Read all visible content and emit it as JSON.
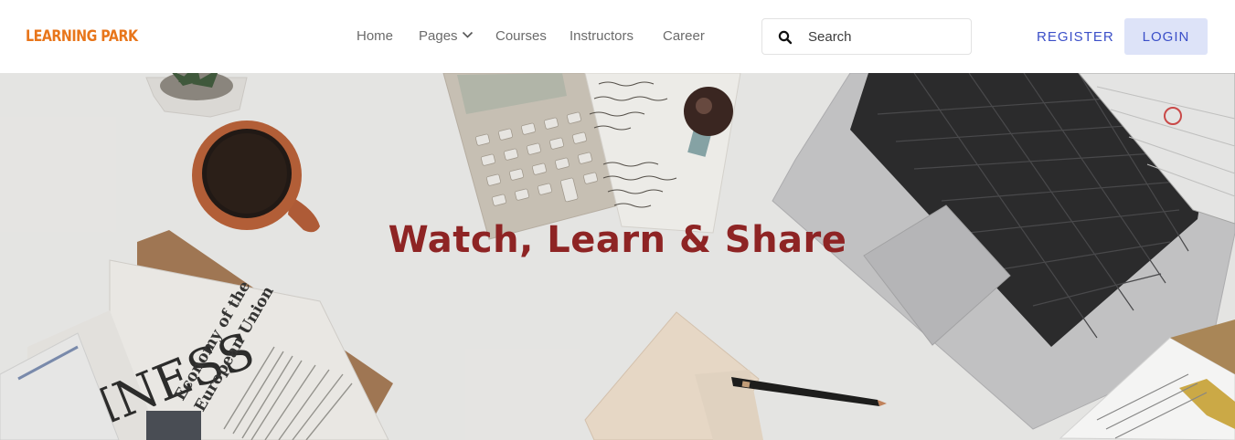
{
  "brand": {
    "logo_text": "LEARNING PARK",
    "logo_color": "#e8761b"
  },
  "nav": {
    "items": [
      {
        "label": "Home"
      },
      {
        "label": "Pages",
        "has_dropdown": true,
        "icon": "chevron-down-icon"
      },
      {
        "label": "Courses"
      },
      {
        "label": "Instructors"
      },
      {
        "label": "Career"
      }
    ]
  },
  "search": {
    "placeholder": "Search",
    "value": "",
    "icon": "search-icon"
  },
  "auth": {
    "register_label": "REGISTER",
    "login_label": "LOGIN",
    "accent_color": "#3b4fc8"
  },
  "hero": {
    "title": "Watch, Learn & Share",
    "title_color": "#8e2424",
    "background": "desk-workspace-photo"
  }
}
